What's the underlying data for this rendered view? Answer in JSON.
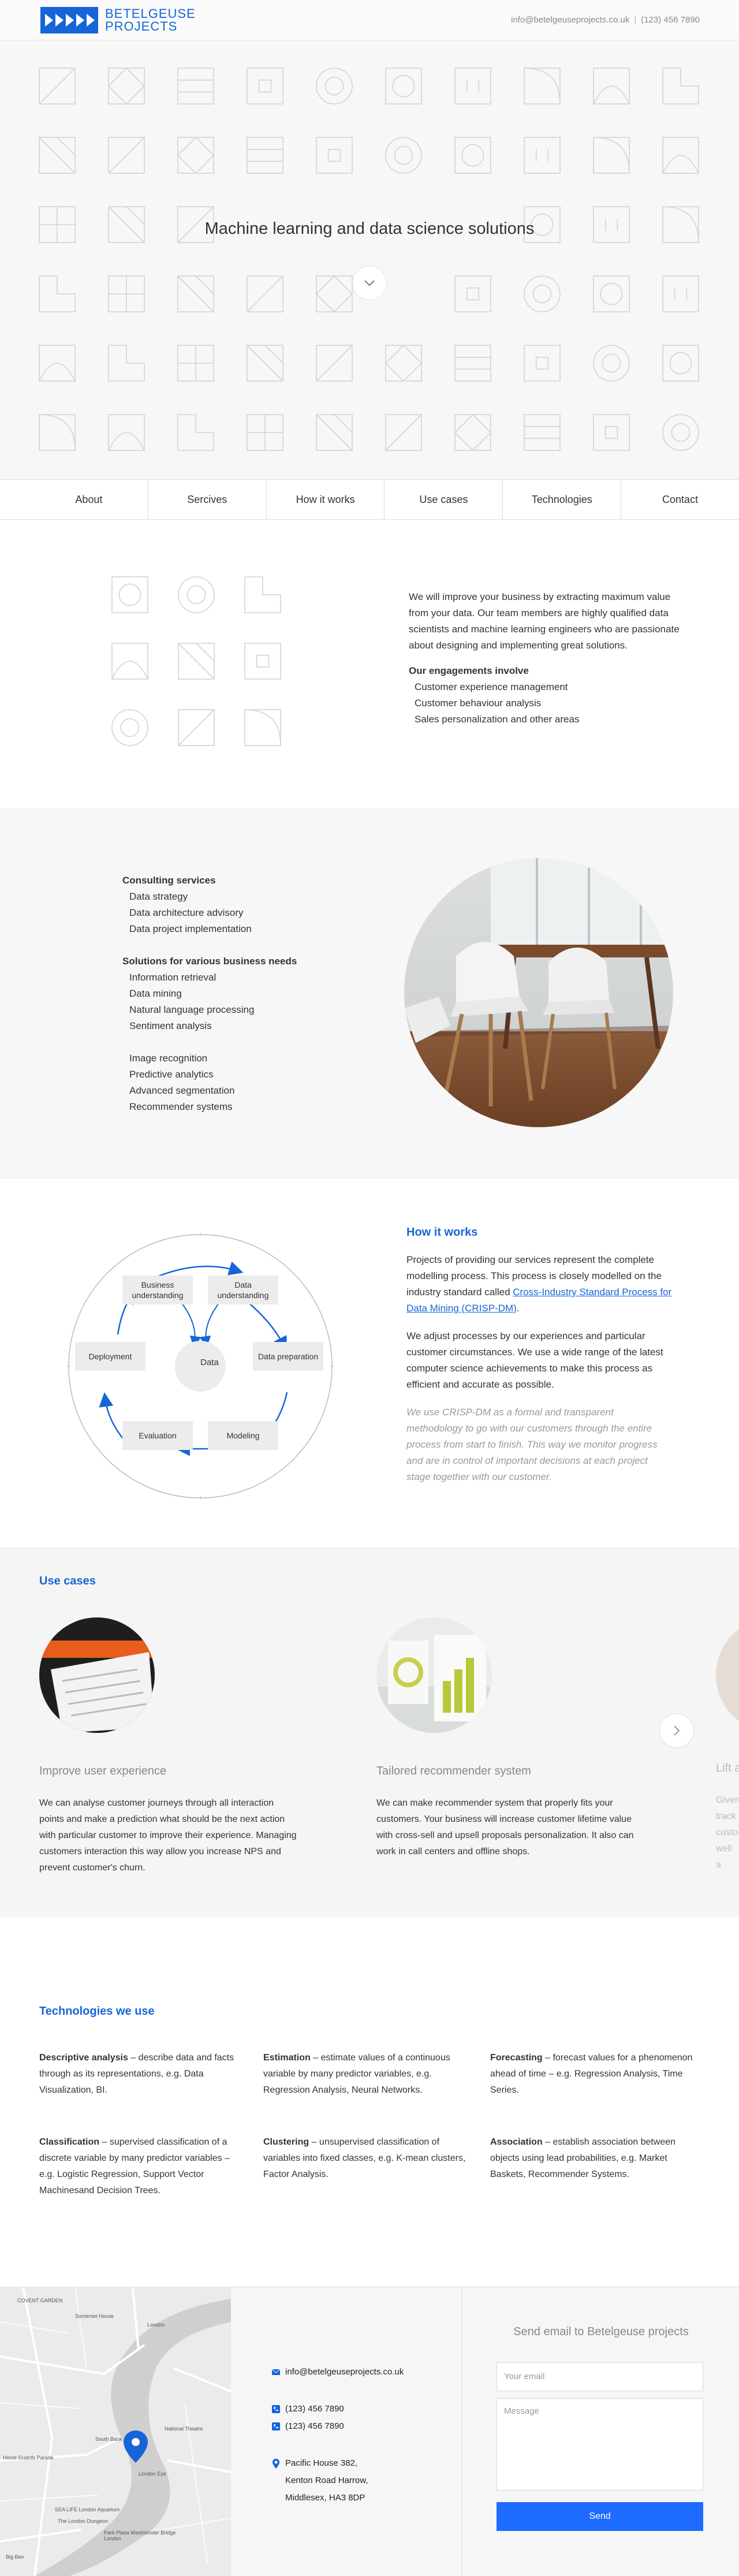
{
  "header": {
    "logo_line1": "BETELGEUSE",
    "logo_line2": "PROJECTS",
    "email": "info@betelgeuseprojects.co.uk",
    "separator": "|",
    "phone": "(123) 456 7890"
  },
  "hero": {
    "title": "Machine learning and data science solutions"
  },
  "nav": {
    "items": [
      "About",
      "Sercives",
      "How it works",
      "Use cases",
      "Technologies",
      "Contact"
    ]
  },
  "about": {
    "intro": "We will improve your business by extracting maximum value from your data. Our team members are highly qualified data scientists and machine learning engineers who are passionate about designing and implementing great solutions.",
    "engagements_title": "Our engagements involve",
    "engagements": [
      "Customer experience management",
      "Customer behaviour analysis",
      "Sales personalization and other areas"
    ]
  },
  "services": {
    "consulting_title": "Consulting services",
    "consulting": [
      "Data strategy",
      "Data architecture advisory",
      "Data project implementation"
    ],
    "solutions_title": "Solutions for various business needs",
    "solutions_a": [
      "Information retrieval",
      "Data mining",
      "Natural language processing",
      "Sentiment analysis"
    ],
    "solutions_b": [
      "Image recognition",
      "Predictive analytics",
      "Advanced segmentation",
      "Recommender systems"
    ]
  },
  "how": {
    "title": "How it works",
    "p1_before": "Projects of providing our services represent the complete modelling process. This process is closely modelled on the industry standard called ",
    "p1_link": "Cross-Industry Standard Process for Data Mining (CRISP-DM)",
    "p1_after": ".",
    "p2": "We adjust processes by our experiences and particular customer circumstances. We use a wide range of the latest computer science achievements to make this process as efficient and accurate as possible.",
    "p3": "We use CRISP-DM as a formal and transparent methodology to go with our customers through the entire process from start to finish. This way we monitor progress and are in control of important decisions at each project stage together with our customer.",
    "diagram": {
      "center": "Data",
      "business": "Business understanding",
      "data_understanding": "Data understanding",
      "data_preparation": "Data preparation",
      "modeling": "Modeling",
      "evaluation": "Evaluation",
      "deployment": "Deployment"
    }
  },
  "use_cases": {
    "title": "Use cases",
    "cards": [
      {
        "title": "Improve user experience",
        "desc": "We can analyse customer journeys through all interaction points and make a prediction what should be the next action with particular customer to improve their experience. Managing customers interaction this way allow you increase NPS and prevent customer's churn."
      },
      {
        "title": "Tailored recommender system",
        "desc": "We can make recommender system that properly fits your customers. Your business will increase customer lifetime value with cross-sell and upsell proposals personalization. It also can work in call centers and offline shops."
      },
      {
        "title": "Lift a",
        "desc": "Given track custo well a"
      }
    ]
  },
  "technologies": {
    "title": "Technologies we use",
    "items": [
      {
        "term": "Descriptive analysis",
        "desc": " – describe data and facts through as its representations, e.g. Data Visualization, BI."
      },
      {
        "term": "Estimation",
        "desc": " – estimate values of a continuous variable by many predictor variables, e.g. Regression Analysis, Neural Networks."
      },
      {
        "term": "Forecasting",
        "desc": " – forecast values for a phenomenon ahead of time – e.g. Regression Analysis, Time Series."
      },
      {
        "term": "Classification",
        "desc": " – supervised classification of a discrete variable by many predictor variables – e.g. Logistic Regression, Support Vector Machinesand Decision Trees."
      },
      {
        "term": "Clustering",
        "desc": " – unsupervised classification of variables into fixed classes, e.g. K-mean clusters, Factor Analysis."
      },
      {
        "term": "Association",
        "desc": " – establish association between objects using lead probabilities, e.g. Market Baskets, Recommender Systems."
      }
    ]
  },
  "footer": {
    "email": "info@betelgeuseprojects.co.uk",
    "phone1": "(123) 456 7890",
    "phone2": "(123) 456 7890",
    "address": [
      "Pacific House 382,",
      "Kenton Road Harrow,",
      "Middlesex, HA3 8DP"
    ],
    "form_title": "Send email to Betelgeuse projects",
    "email_placeholder": "Your email",
    "message_placeholder": "Message",
    "send_label": "Send",
    "map_labels": [
      "COVENT GARDEN",
      "Somerset House",
      "London",
      "Horse Guards Parade",
      "National Theatre",
      "South Bank",
      "London Eye",
      "SEA LIFE London Aquarium",
      "The London Dungeon",
      "Park Plaza Westminster Bridge London",
      "Big Ben"
    ]
  },
  "colors": {
    "accent": "#1565d8",
    "tile_stroke": "#d3d3d3",
    "hero_bg": "#f7f7f7"
  }
}
